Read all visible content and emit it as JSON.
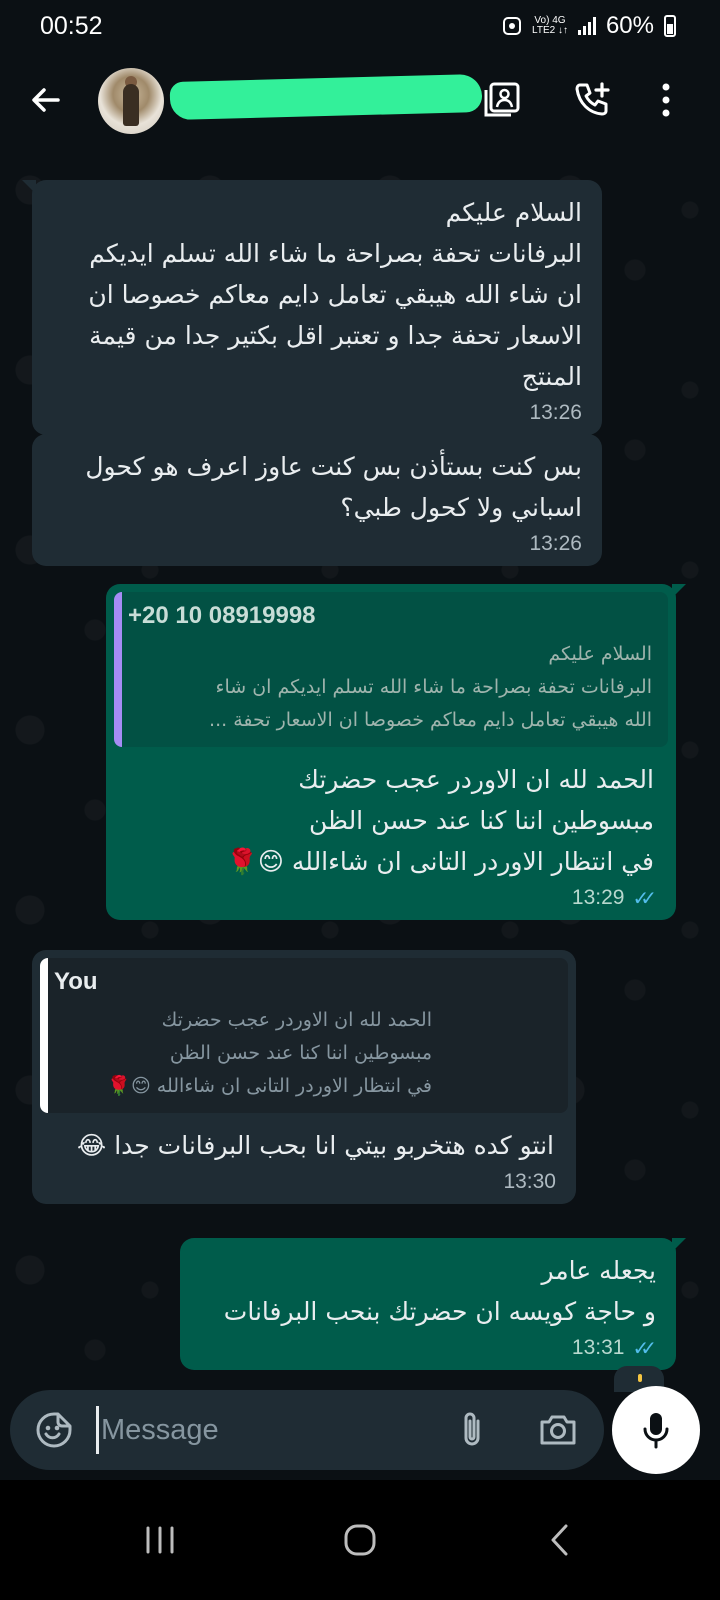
{
  "status_bar": {
    "time": "00:52",
    "network_top": "Vo) 4G",
    "network_bottom": "LTE2 ↓↑",
    "battery": "60%"
  },
  "header": {
    "back_icon": "arrow-left-icon",
    "contact_name_redacted": true,
    "icons": [
      "contact-card-icon",
      "add-call-icon",
      "more-vertical-icon"
    ]
  },
  "messages": [
    {
      "direction": "incoming",
      "text": "السلام عليكم\nالبرفانات تحفة بصراحة ما شاء الله تسلم ايديكم\nان شاء الله هيبقي تعامل دايم معاكم خصوصا ان\nالاسعار تحفة جدا و تعتبر اقل بكتير جدا من قيمة\nالمنتج",
      "time": "13:26"
    },
    {
      "direction": "incoming",
      "text": "بس كنت بستأذن بس كنت عاوز اعرف هو كحول\nاسباني ولا كحول طبي؟",
      "time": "13:26"
    },
    {
      "direction": "outgoing",
      "quote_author": "+20 10 08919998",
      "quote_text": "السلام عليكم\nالبرفانات تحفة بصراحة ما شاء الله تسلم ايديكم ان شاء\nالله هيبقي تعامل دايم معاكم خصوصا ان الاسعار تحفة ...",
      "text": "الحمد لله  ان الاوردر عجب حضرتك\nمبسوطين اننا كنا عند حسن الظن\nفي انتظار الاوردر التانى ان شاءالله 😊🌹",
      "time": "13:29",
      "read": true
    },
    {
      "direction": "incoming",
      "quote_author": "You",
      "quote_text": "الحمد لله  ان الاوردر عجب حضرتك\nمبسوطين اننا كنا عند حسن الظن\nفي انتظار الاوردر التانى ان شاءالله 😊🌹",
      "text": "انتو كده هتخربو بيتي انا بحب البرفانات جدا 😂",
      "time": "13:30"
    },
    {
      "direction": "outgoing",
      "text": "يجعله عامر\nو  حاجة كويسه ان حضرتك بنحب  البرفانات",
      "time": "13:31",
      "read": true
    }
  ],
  "composer": {
    "placeholder": "Message",
    "icons": [
      "sticker-emoji-icon",
      "paperclip-icon",
      "camera-icon",
      "microphone-icon"
    ]
  },
  "nav": {
    "icons": [
      "recents-icon",
      "home-icon",
      "back-icon"
    ]
  },
  "colors": {
    "background": "#0b1014",
    "incoming_bubble": "#1f2c34",
    "outgoing_bubble": "#005c4b",
    "read_ticks": "#53bdeb",
    "quote_accent": "#a68cf5",
    "redaction": "#33f09a"
  }
}
